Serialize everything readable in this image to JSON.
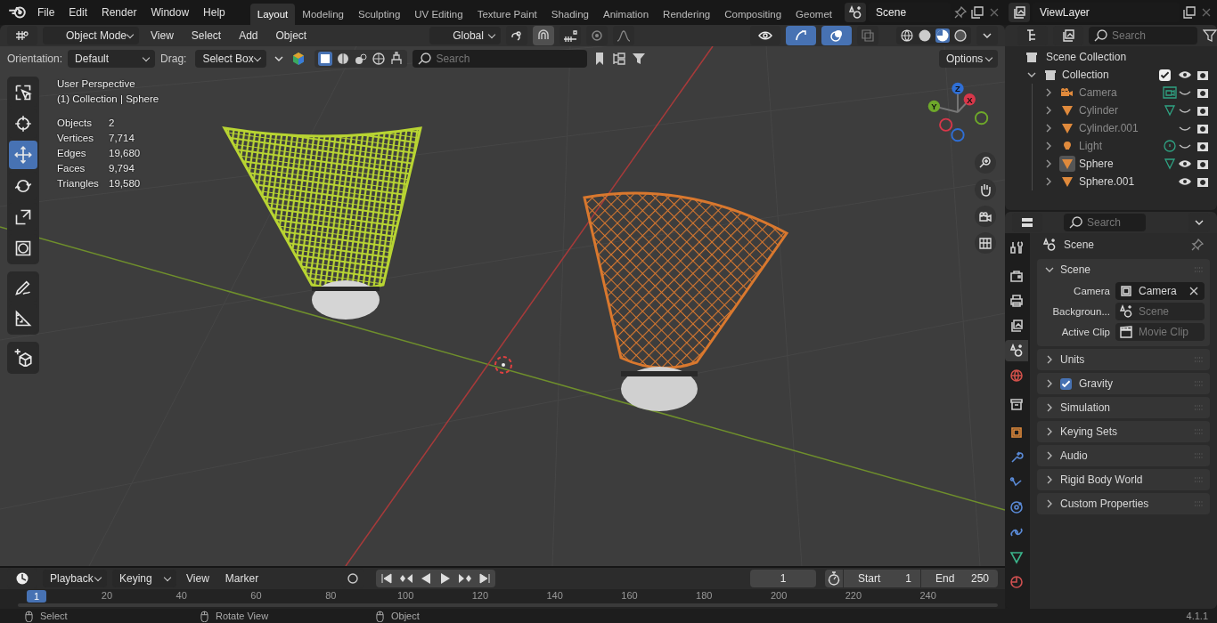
{
  "menus": [
    "File",
    "Edit",
    "Render",
    "Window",
    "Help"
  ],
  "workspaces": [
    {
      "label": "Layout",
      "selected": true
    },
    {
      "label": "Modeling",
      "selected": false
    },
    {
      "label": "Sculpting",
      "selected": false
    },
    {
      "label": "UV Editing",
      "selected": false
    },
    {
      "label": "Texture Paint",
      "selected": false
    },
    {
      "label": "Shading",
      "selected": false
    },
    {
      "label": "Animation",
      "selected": false
    },
    {
      "label": "Rendering",
      "selected": false
    },
    {
      "label": "Compositing",
      "selected": false
    },
    {
      "label": "Geomet",
      "selected": false
    }
  ],
  "scene": "Scene",
  "view_layer": "ViewLayer",
  "viewport_header": {
    "mode": "Object Mode",
    "menus": [
      "View",
      "Select",
      "Add",
      "Object"
    ],
    "transform_orientation": "Global",
    "snap": true,
    "show_gizmo": true,
    "show_overlays": true,
    "xray": false
  },
  "tool_settings": {
    "orientation_label": "Orientation:",
    "orientation": "Default",
    "drag_label": "Drag:",
    "drag": "Select Box",
    "search_placeholder": "Search",
    "options": "Options"
  },
  "viewport": {
    "view_name": "User Perspective",
    "context": "(1) Collection | Sphere",
    "stats": [
      {
        "label": "Objects",
        "value": "2"
      },
      {
        "label": "Vertices",
        "value": "7,714"
      },
      {
        "label": "Edges",
        "value": "19,680"
      },
      {
        "label": "Faces",
        "value": "9,794"
      },
      {
        "label": "Triangles",
        "value": "19,580"
      }
    ],
    "tool_groups": [
      [
        {
          "kind": "select",
          "selected": false
        },
        {
          "kind": "cursor",
          "selected": false
        },
        {
          "kind": "move",
          "selected": true
        },
        {
          "kind": "rotate",
          "selected": false
        },
        {
          "kind": "scale",
          "selected": false
        },
        {
          "kind": "transform",
          "selected": false
        }
      ],
      [
        {
          "kind": "annotate",
          "selected": false
        },
        {
          "kind": "measure",
          "selected": false
        }
      ],
      [
        {
          "kind": "add_cube",
          "selected": false
        }
      ]
    ],
    "gizmo_axes": [
      "Z",
      "Y",
      "X"
    ]
  },
  "outliner": {
    "search_placeholder": "Search",
    "root": "Scene Collection",
    "collections": [
      {
        "label": "Collection",
        "expanded": true,
        "checked": true,
        "children": [
          {
            "label": "Camera",
            "kind": "camera",
            "data": {
              "kind": "camera"
            },
            "visible": false,
            "active": false
          },
          {
            "label": "Cylinder",
            "kind": "mesh",
            "data": {
              "kind": "mesh"
            },
            "visible": false,
            "active": false
          },
          {
            "label": "Cylinder.001",
            "kind": "mesh",
            "visible": false,
            "active": false
          },
          {
            "label": "Light",
            "kind": "light",
            "data": {
              "kind": "light"
            },
            "visible": false,
            "active": false
          },
          {
            "label": "Sphere",
            "kind": "mesh",
            "data": {
              "kind": "mesh"
            },
            "visible": true,
            "active": true
          },
          {
            "label": "Sphere.001",
            "kind": "mesh",
            "visible": true,
            "active": false
          }
        ]
      }
    ]
  },
  "properties": {
    "search_placeholder": "Search",
    "context": "Scene",
    "tab_groups": [
      [
        {
          "kind": "tool",
          "selected": false
        }
      ],
      [
        {
          "kind": "render",
          "selected": false
        },
        {
          "kind": "output",
          "selected": false
        },
        {
          "kind": "view_layer",
          "selected": false
        },
        {
          "kind": "scene",
          "selected": true
        },
        {
          "kind": "world",
          "selected": false
        }
      ],
      [
        {
          "kind": "collection",
          "selected": false
        }
      ],
      [
        {
          "kind": "object",
          "selected": false
        },
        {
          "kind": "modifier",
          "selected": false
        },
        {
          "kind": "particles",
          "selected": false
        },
        {
          "kind": "physics",
          "selected": false
        },
        {
          "kind": "constraints",
          "selected": false
        },
        {
          "kind": "data",
          "selected": false
        },
        {
          "kind": "material",
          "selected": false
        }
      ]
    ],
    "panels": [
      {
        "label": "Scene",
        "expanded": true,
        "fields": [
          {
            "label": "Camera",
            "kind": "object",
            "value": "Camera"
          },
          {
            "label": "Backgroun...",
            "kind": "scene",
            "placeholder": "Scene"
          },
          {
            "label": "Active Clip",
            "kind": "clip",
            "placeholder": "Movie Clip"
          }
        ]
      },
      {
        "label": "Units",
        "expanded": false
      },
      {
        "label": "Gravity",
        "expanded": false,
        "checked": true
      },
      {
        "label": "Simulation",
        "expanded": false
      },
      {
        "label": "Keying Sets",
        "expanded": false
      },
      {
        "label": "Audio",
        "expanded": false
      },
      {
        "label": "Rigid Body World",
        "expanded": false
      },
      {
        "label": "Custom Properties",
        "expanded": false
      }
    ]
  },
  "timeline": {
    "menus": [
      {
        "label": "Playback",
        "dropdown": true
      },
      {
        "label": "Keying",
        "dropdown": true
      },
      {
        "label": "View",
        "dropdown": false
      },
      {
        "label": "Marker",
        "dropdown": false
      }
    ],
    "current_frame": "1",
    "start_label": "Start",
    "start": "1",
    "end_label": "End",
    "end": "250",
    "playhead": "1",
    "ticks": [
      "20",
      "40",
      "60",
      "80",
      "100",
      "120",
      "140",
      "160",
      "180",
      "200",
      "220",
      "240"
    ]
  },
  "status_bar": {
    "items": [
      "Select",
      "Rotate View",
      "Object"
    ],
    "version": "4.1.1"
  }
}
